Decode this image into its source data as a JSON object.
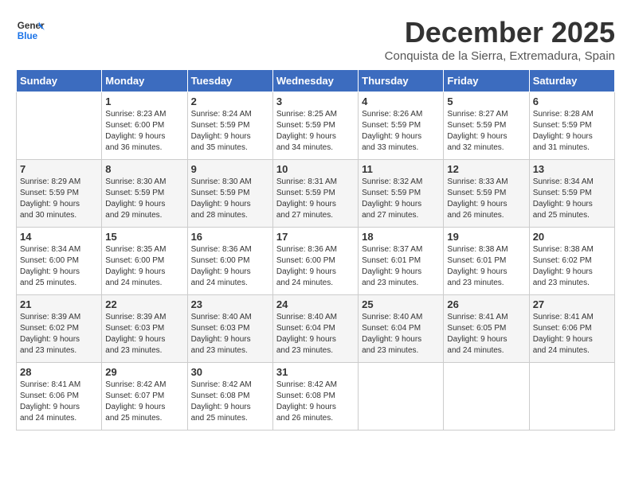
{
  "logo": {
    "line1": "General",
    "line2": "Blue"
  },
  "title": "December 2025",
  "subtitle": "Conquista de la Sierra, Extremadura, Spain",
  "days_of_week": [
    "Sunday",
    "Monday",
    "Tuesday",
    "Wednesday",
    "Thursday",
    "Friday",
    "Saturday"
  ],
  "weeks": [
    [
      {
        "num": "",
        "info": ""
      },
      {
        "num": "1",
        "info": "Sunrise: 8:23 AM\nSunset: 6:00 PM\nDaylight: 9 hours\nand 36 minutes."
      },
      {
        "num": "2",
        "info": "Sunrise: 8:24 AM\nSunset: 5:59 PM\nDaylight: 9 hours\nand 35 minutes."
      },
      {
        "num": "3",
        "info": "Sunrise: 8:25 AM\nSunset: 5:59 PM\nDaylight: 9 hours\nand 34 minutes."
      },
      {
        "num": "4",
        "info": "Sunrise: 8:26 AM\nSunset: 5:59 PM\nDaylight: 9 hours\nand 33 minutes."
      },
      {
        "num": "5",
        "info": "Sunrise: 8:27 AM\nSunset: 5:59 PM\nDaylight: 9 hours\nand 32 minutes."
      },
      {
        "num": "6",
        "info": "Sunrise: 8:28 AM\nSunset: 5:59 PM\nDaylight: 9 hours\nand 31 minutes."
      }
    ],
    [
      {
        "num": "7",
        "info": "Sunrise: 8:29 AM\nSunset: 5:59 PM\nDaylight: 9 hours\nand 30 minutes."
      },
      {
        "num": "8",
        "info": "Sunrise: 8:30 AM\nSunset: 5:59 PM\nDaylight: 9 hours\nand 29 minutes."
      },
      {
        "num": "9",
        "info": "Sunrise: 8:30 AM\nSunset: 5:59 PM\nDaylight: 9 hours\nand 28 minutes."
      },
      {
        "num": "10",
        "info": "Sunrise: 8:31 AM\nSunset: 5:59 PM\nDaylight: 9 hours\nand 27 minutes."
      },
      {
        "num": "11",
        "info": "Sunrise: 8:32 AM\nSunset: 5:59 PM\nDaylight: 9 hours\nand 27 minutes."
      },
      {
        "num": "12",
        "info": "Sunrise: 8:33 AM\nSunset: 5:59 PM\nDaylight: 9 hours\nand 26 minutes."
      },
      {
        "num": "13",
        "info": "Sunrise: 8:34 AM\nSunset: 5:59 PM\nDaylight: 9 hours\nand 25 minutes."
      }
    ],
    [
      {
        "num": "14",
        "info": "Sunrise: 8:34 AM\nSunset: 6:00 PM\nDaylight: 9 hours\nand 25 minutes."
      },
      {
        "num": "15",
        "info": "Sunrise: 8:35 AM\nSunset: 6:00 PM\nDaylight: 9 hours\nand 24 minutes."
      },
      {
        "num": "16",
        "info": "Sunrise: 8:36 AM\nSunset: 6:00 PM\nDaylight: 9 hours\nand 24 minutes."
      },
      {
        "num": "17",
        "info": "Sunrise: 8:36 AM\nSunset: 6:00 PM\nDaylight: 9 hours\nand 24 minutes."
      },
      {
        "num": "18",
        "info": "Sunrise: 8:37 AM\nSunset: 6:01 PM\nDaylight: 9 hours\nand 23 minutes."
      },
      {
        "num": "19",
        "info": "Sunrise: 8:38 AM\nSunset: 6:01 PM\nDaylight: 9 hours\nand 23 minutes."
      },
      {
        "num": "20",
        "info": "Sunrise: 8:38 AM\nSunset: 6:02 PM\nDaylight: 9 hours\nand 23 minutes."
      }
    ],
    [
      {
        "num": "21",
        "info": "Sunrise: 8:39 AM\nSunset: 6:02 PM\nDaylight: 9 hours\nand 23 minutes."
      },
      {
        "num": "22",
        "info": "Sunrise: 8:39 AM\nSunset: 6:03 PM\nDaylight: 9 hours\nand 23 minutes."
      },
      {
        "num": "23",
        "info": "Sunrise: 8:40 AM\nSunset: 6:03 PM\nDaylight: 9 hours\nand 23 minutes."
      },
      {
        "num": "24",
        "info": "Sunrise: 8:40 AM\nSunset: 6:04 PM\nDaylight: 9 hours\nand 23 minutes."
      },
      {
        "num": "25",
        "info": "Sunrise: 8:40 AM\nSunset: 6:04 PM\nDaylight: 9 hours\nand 23 minutes."
      },
      {
        "num": "26",
        "info": "Sunrise: 8:41 AM\nSunset: 6:05 PM\nDaylight: 9 hours\nand 24 minutes."
      },
      {
        "num": "27",
        "info": "Sunrise: 8:41 AM\nSunset: 6:06 PM\nDaylight: 9 hours\nand 24 minutes."
      }
    ],
    [
      {
        "num": "28",
        "info": "Sunrise: 8:41 AM\nSunset: 6:06 PM\nDaylight: 9 hours\nand 24 minutes."
      },
      {
        "num": "29",
        "info": "Sunrise: 8:42 AM\nSunset: 6:07 PM\nDaylight: 9 hours\nand 25 minutes."
      },
      {
        "num": "30",
        "info": "Sunrise: 8:42 AM\nSunset: 6:08 PM\nDaylight: 9 hours\nand 25 minutes."
      },
      {
        "num": "31",
        "info": "Sunrise: 8:42 AM\nSunset: 6:08 PM\nDaylight: 9 hours\nand 26 minutes."
      },
      {
        "num": "",
        "info": ""
      },
      {
        "num": "",
        "info": ""
      },
      {
        "num": "",
        "info": ""
      }
    ]
  ]
}
